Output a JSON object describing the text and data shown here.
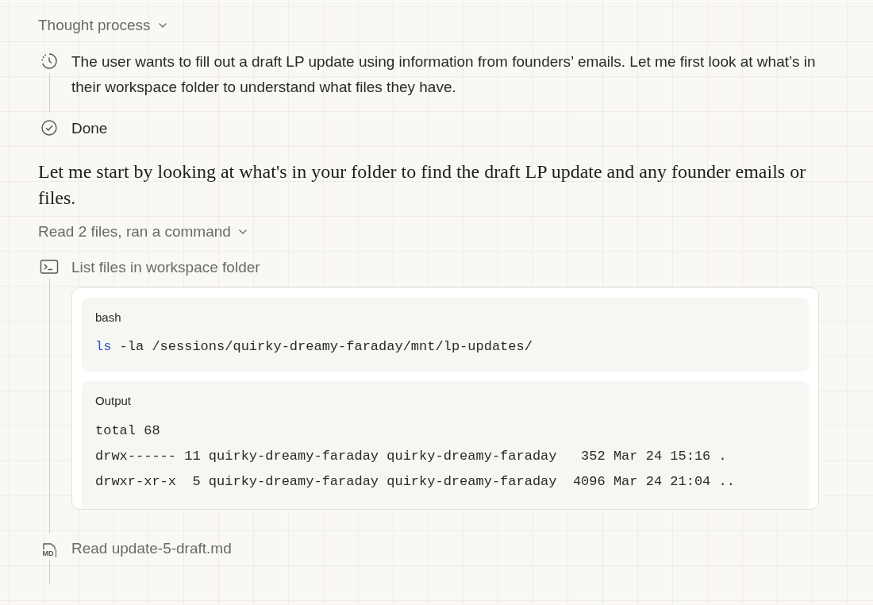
{
  "thought_process": {
    "label": "Thought process",
    "steps": [
      {
        "kind": "thinking",
        "text": "The user wants to fill out a draft LP update using information from founders’ emails. Let me first look at what’s in their workspace folder to understand what files they have."
      },
      {
        "kind": "done",
        "text": "Done"
      }
    ]
  },
  "message": "Let me start by looking at what's in your folder to find the draft LP update and any founder emails or files.",
  "tool_group": {
    "label": "Read 2 files, ran a command",
    "steps": [
      {
        "kind": "command",
        "label": "List files in workspace folder",
        "code": {
          "language": "bash",
          "command": "ls",
          "args": " -la /sessions/quirky-dreamy-faraday/mnt/lp-updates/",
          "output_label": "Output",
          "output_lines": [
            "total 68",
            "drwx------ 11 quirky-dreamy-faraday quirky-dreamy-faraday   352 Mar 24 15:16 .",
            "drwxr-xr-x  5 quirky-dreamy-faraday quirky-dreamy-faraday  4096 Mar 24 21:04 .."
          ]
        }
      },
      {
        "kind": "file",
        "label": "Read update-5-draft.md",
        "badge": "MD"
      }
    ]
  }
}
